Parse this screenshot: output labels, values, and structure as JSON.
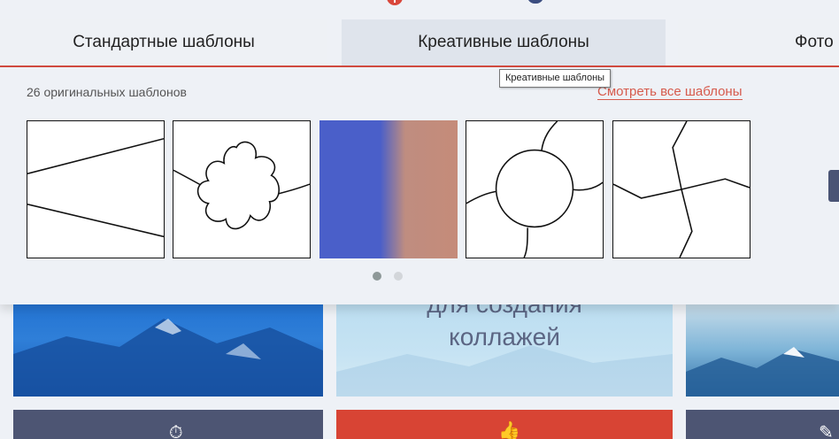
{
  "tabs": [
    {
      "label": "Стандартные шаблоны"
    },
    {
      "label": "Креативные шаблоны"
    },
    {
      "label": "Фото"
    }
  ],
  "tooltip": {
    "text": "Креативные шаблоны"
  },
  "panel": {
    "count_text": "26 оригинальных шаблонов",
    "see_all_link": "Смотреть все шаблоны",
    "templates": [
      {
        "name": "wedge-layout"
      },
      {
        "name": "flower-layout"
      },
      {
        "name": "gradient-layout"
      },
      {
        "name": "circle-layout"
      },
      {
        "name": "puzzle-layout"
      }
    ],
    "pagination": {
      "total": 2,
      "active": 1
    }
  },
  "background": {
    "center_text_line1": "для создания",
    "center_text_line2": "коллажей"
  },
  "colors": {
    "accent": "#d04a3f",
    "link": "#d65a4c",
    "dark_tile": "#4d5573",
    "red_tile": "#d84434"
  }
}
